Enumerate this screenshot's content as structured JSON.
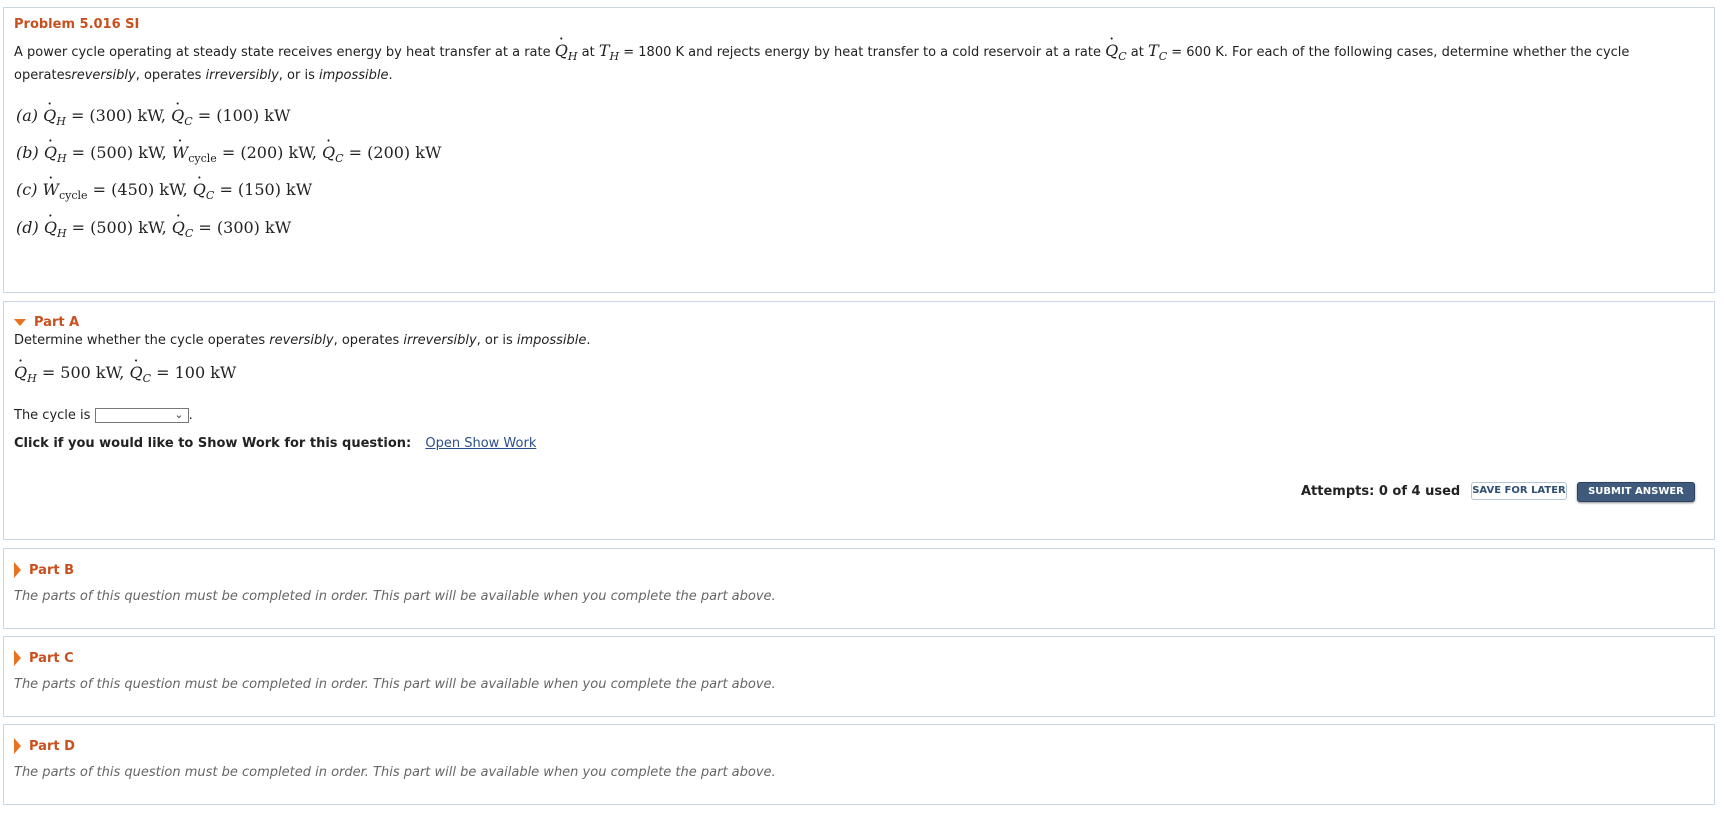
{
  "problem": {
    "title": "Problem 5.016 SI",
    "text_part1": "A power cycle operating at steady state receives energy by heat transfer at a rate",
    "text_at1": "at",
    "text_eq1": "= 1800 K and rejects energy by heat transfer to a cold reservoir at a rate",
    "text_at2": "at",
    "text_eq2": "= 600 K. For each of the following cases, determine whether the cycle operates",
    "w_reversibly": "reversibly",
    "text_operates": ", operates",
    "w_irreversibly": "irreversibly",
    "text_oris": ", or is",
    "w_impossible": "impossible",
    "text_end": ".",
    "cases": [
      {
        "label": "(a)",
        "expr": "= (300) kW, ",
        "expr2": "= (100)  kW"
      },
      {
        "label": "(b)",
        "expr": "= (500) kW, ",
        "mid": "= (200) kW, ",
        "expr2": "= (200) kW"
      },
      {
        "label": "(c)",
        "mid": "= (450) kW, ",
        "expr2": "= (150) kW"
      },
      {
        "label": "(d)",
        "expr": "= (500) kW, ",
        "expr2": "= (300) kW"
      }
    ]
  },
  "partA": {
    "title": "Part A",
    "instr_pre": "Determine whether the cycle operates ",
    "instr_rev": "reversibly",
    "instr_mid": ", operates ",
    "instr_irr": "irreversibly",
    "instr_or": ", or is ",
    "instr_imp": "impossible",
    "instr_end": ".",
    "given_qh": "= 500 kW, ",
    "given_qc": "= 100 kW",
    "cycle_label": "The cycle is",
    "select_value": "",
    "showwork_label": "Click if you would like to Show Work for this question:",
    "showwork_link": "Open Show Work",
    "attempts": "Attempts: 0 of 4 used",
    "save_label": "SAVE FOR LATER",
    "submit_label": "SUBMIT ANSWER"
  },
  "locked_parts": [
    {
      "title": "Part B",
      "message": "The parts of this question must be completed in order. This part will be available when you complete the part above."
    },
    {
      "title": "Part C",
      "message": "The parts of this question must be completed in order. This part will be available when you complete the part above."
    },
    {
      "title": "Part D",
      "message": "The parts of this question must be completed in order. This part will be available when you complete the part above."
    }
  ],
  "symbols": {
    "Q": "Q",
    "W": "W",
    "T": "T",
    "H": "H",
    "C": "C",
    "cycle": "cycle"
  },
  "colors": {
    "accent": "#c8501e",
    "arrow": "#e8721f",
    "border": "#c9d6e3",
    "submit": "#3f5a7a"
  }
}
